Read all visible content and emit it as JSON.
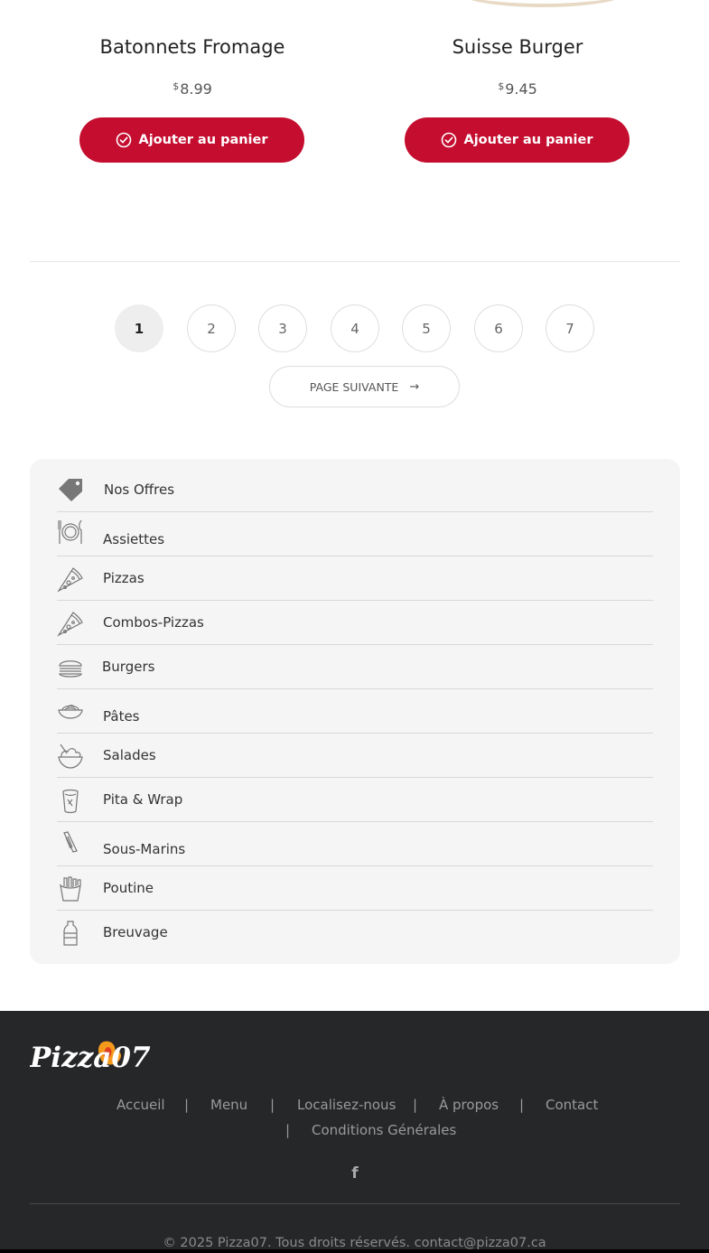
{
  "products": [
    {
      "name": "Batonnets Fromage",
      "currency": "$",
      "price": "8.99",
      "button_label": "Ajouter au panier"
    },
    {
      "name": "Suisse Burger",
      "currency": "$",
      "price": "9.45",
      "button_label": "Ajouter au panier"
    }
  ],
  "pagination": {
    "pages": [
      "1",
      "2",
      "3",
      "4",
      "5",
      "6",
      "7"
    ],
    "current": "1",
    "next_label": "PAGE SUIVANTE",
    "next_arrow": "→"
  },
  "categories": [
    {
      "label": "Nos Offres",
      "icon": "tag-icon"
    },
    {
      "label": "Assiettes",
      "icon": "plate-icon"
    },
    {
      "label": "Pizzas",
      "icon": "pizza-slice-icon"
    },
    {
      "label": "Combos-Pizzas",
      "icon": "pizza-slice-icon"
    },
    {
      "label": "Burgers",
      "icon": "burger-icon"
    },
    {
      "label": "Pâtes",
      "icon": "pasta-icon"
    },
    {
      "label": "Salades",
      "icon": "salad-bowl-icon"
    },
    {
      "label": "Pita & Wrap",
      "icon": "wrap-icon"
    },
    {
      "label": "Sous-Marins",
      "icon": "sub-sandwich-icon"
    },
    {
      "label": "Poutine",
      "icon": "fries-icon"
    },
    {
      "label": "Breuvage",
      "icon": "bottle-icon"
    }
  ],
  "footer": {
    "logo_text": "Pizza07",
    "links": [
      "Accueil",
      "Menu",
      "Localisez-nous",
      "À propos",
      "Contact",
      "Conditions Générales"
    ],
    "separator": "|",
    "social": "f",
    "copyright": "© 2025 Pizza07. Tous droits réservés. contact@pizza07.ca"
  },
  "colors": {
    "accent": "#c40d2f",
    "footer_bg": "#262729",
    "category_bg": "#f5f5f5"
  }
}
